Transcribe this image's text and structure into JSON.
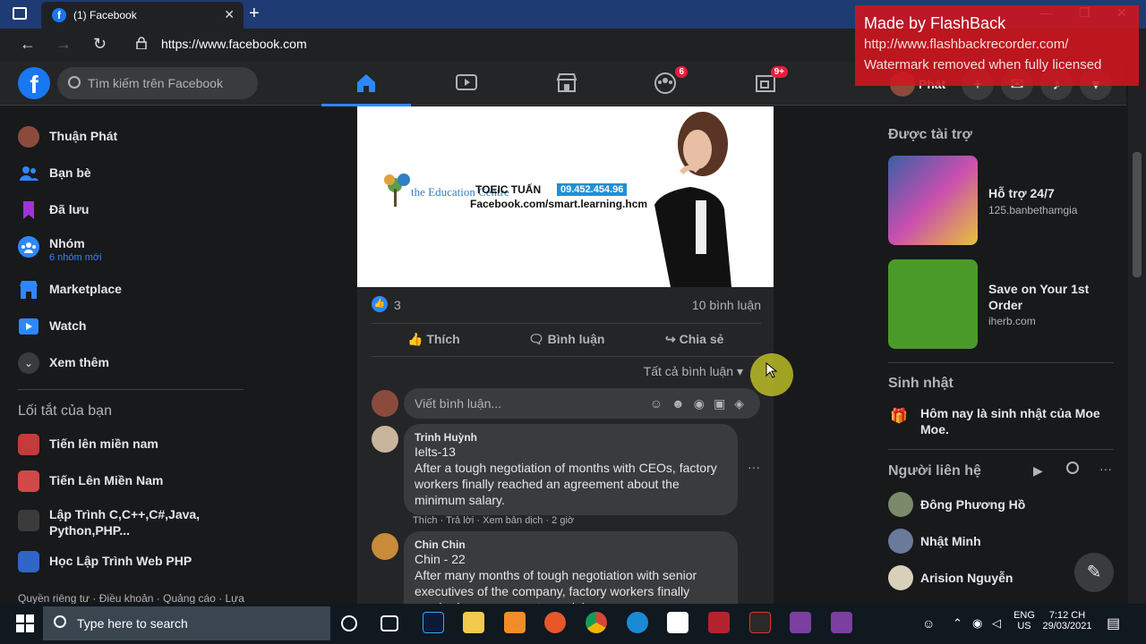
{
  "browser": {
    "tab_title": "(1) Facebook",
    "tab_favicon": "f",
    "url": "https://www.facebook.com",
    "new_tab": "+",
    "close_tab": "✕",
    "window_controls": [
      "—",
      "❐",
      "✕"
    ]
  },
  "watermark": {
    "line1": "Made by FlashBack",
    "line2": "http://www.flashbackrecorder.com/",
    "line3": "Watermark removed when fully licensed"
  },
  "topbar": {
    "logo": "f",
    "search_placeholder": "Tìm kiếm trên Facebook",
    "groups_badge": "6",
    "gaming_badge": "9+",
    "profile_name": "Phát"
  },
  "left_menu": {
    "items": [
      {
        "label": "Thuận Phát",
        "icon": "avatar"
      },
      {
        "label": "Bạn bè",
        "icon": "friends-icon"
      },
      {
        "label": "Đã lưu",
        "icon": "bookmark-icon"
      },
      {
        "label": "Nhóm",
        "sub": "6 nhóm mới",
        "icon": "groups-icon"
      },
      {
        "label": "Marketplace",
        "icon": "marketplace-icon"
      },
      {
        "label": "Watch",
        "icon": "watch-icon"
      },
      {
        "label": "Xem thêm",
        "icon": "chevron-down-icon"
      }
    ],
    "shortcuts_title": "Lối tắt của bạn",
    "shortcuts": [
      {
        "label": "Tiến lên miền nam"
      },
      {
        "label": "Tiến Lên Miền Nam"
      },
      {
        "label": "Lập Trình C,C++,C#,Java, Python,PHP..."
      },
      {
        "label": "Học Lập Trình Web PHP"
      }
    ],
    "footer": "Quyền riêng tư · Điều khoản · Quảng cáo · Lựa"
  },
  "post": {
    "image_text_1": "TOEIC TUẤN",
    "image_text_phone": "09.452.454.96",
    "image_text_2": "Facebook.com/smart.learning.hcm",
    "image_logo": "the Education Centre",
    "like_count": "3",
    "comment_count": "10 bình luận",
    "like_label": "Thích",
    "comment_label": "Bình luận",
    "share_label": "Chia sẻ",
    "all_comments": "Tất cả bình luận",
    "write_placeholder": "Viết bình luận...",
    "comments": [
      {
        "name": "Trinh Huỳnh",
        "line1": "Ielts-13",
        "text": "After a tough negotiation of months with CEOs, factory workers finally reached an agreement about the minimum salary.",
        "meta": "Thích · Trả lời · Xem bản dịch · 2 giờ"
      },
      {
        "name": "Chin Chin",
        "line1": "Chin - 22",
        "text": "After many months of tough negotiation with senior executives of the company, factory workers finally reached an agreement on minimum wage."
      }
    ]
  },
  "right": {
    "sponsored_title": "Được tài trợ",
    "ads": [
      {
        "title": "Hỗ trợ 24/7",
        "source": "125.banbethamgia"
      },
      {
        "title": "Save on Your 1st Order",
        "source": "iherb.com"
      }
    ],
    "birthday_title": "Sinh nhật",
    "birthday_text": "Hôm nay là sinh nhật của Moe Moe.",
    "contacts_title": "Người liên hệ",
    "contacts": [
      {
        "name": "Đông Phương Hồ"
      },
      {
        "name": "Nhật Minh"
      },
      {
        "name": "Arision Nguyễn"
      }
    ]
  },
  "taskbar": {
    "search_placeholder": "Type here to search",
    "lang1": "ENG",
    "lang2": "US",
    "time": "7:12 CH",
    "date": "29/03/2021"
  }
}
